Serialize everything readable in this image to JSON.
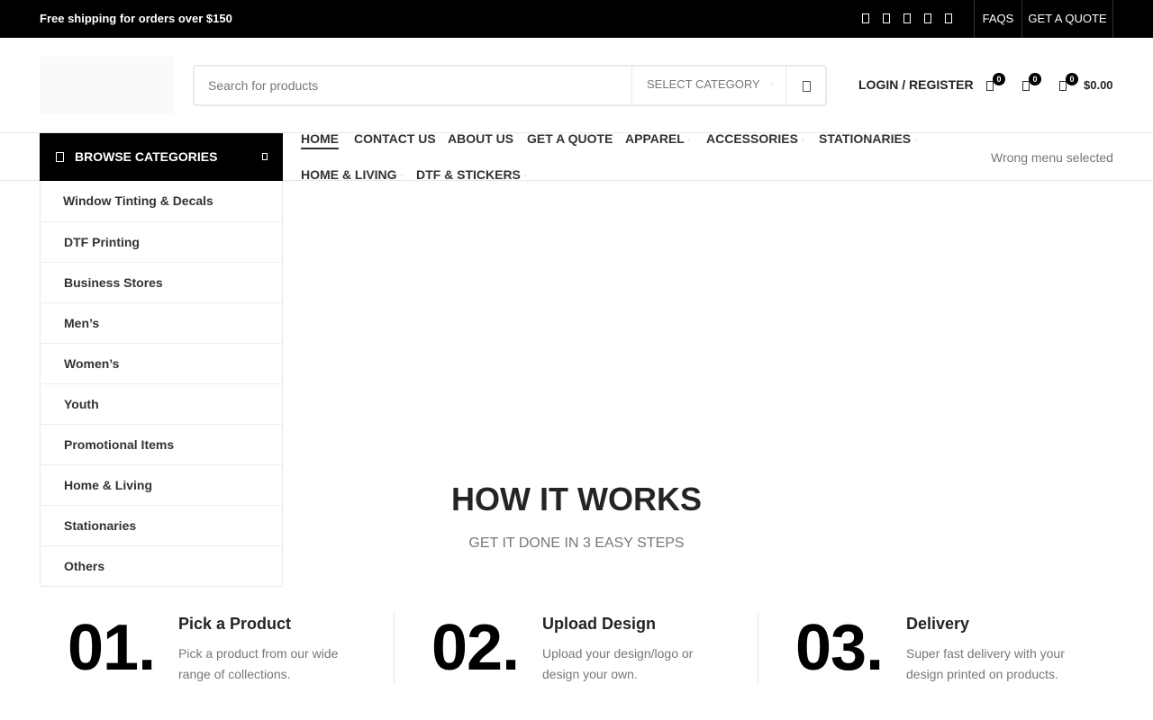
{
  "topbar": {
    "promo": "Free shipping for orders over $150",
    "social_icons": [
      "facebook-icon",
      "twitter-icon",
      "email-icon",
      "pinterest-icon",
      "linkedin-icon"
    ],
    "links": [
      "FAQS",
      "GET A QUOTE"
    ]
  },
  "header": {
    "search_placeholder": "Search for products",
    "category_select": "SELECT CATEGORY",
    "login": "LOGIN / REGISTER",
    "wishlist_count": "0",
    "compare_count": "0",
    "cart_count": "0",
    "cart_total": "$0.00"
  },
  "nav": {
    "browse_label": "BROWSE CATEGORIES",
    "menu": [
      {
        "label": "HOME"
      },
      {
        "label": "CONTACT US"
      },
      {
        "label": "ABOUT US"
      },
      {
        "label": "GET A QUOTE"
      },
      {
        "label": "APPAREL"
      },
      {
        "label": "ACCESSORIES"
      },
      {
        "label": "STATIONARIES"
      },
      {
        "label": "HOME & LIVING"
      },
      {
        "label": "DTF & STICKERS"
      }
    ],
    "secondary_note": "Wrong menu selected"
  },
  "categories": [
    "Window Tinting & Decals",
    "DTF Printing",
    "Business Stores",
    "Men’s",
    "Women’s",
    "Youth",
    "Promotional Items",
    "Home & Living",
    "Stationaries",
    "Others"
  ],
  "how": {
    "title": "HOW IT WORKS",
    "subtitle": "GET IT DONE IN 3 EASY STEPS",
    "steps": [
      {
        "num": "01.",
        "title": "Pick a Product",
        "desc": "Pick a product from our wide range of collections."
      },
      {
        "num": "02.",
        "title": "Upload Design",
        "desc": "Upload your design/logo or design your own."
      },
      {
        "num": "03.",
        "title": "Delivery",
        "desc": "Super fast delivery with your design printed on products."
      }
    ]
  },
  "colors": {
    "topbar_bg": "#000000",
    "accent": "#000000",
    "text": "#242424",
    "muted": "#777777"
  }
}
